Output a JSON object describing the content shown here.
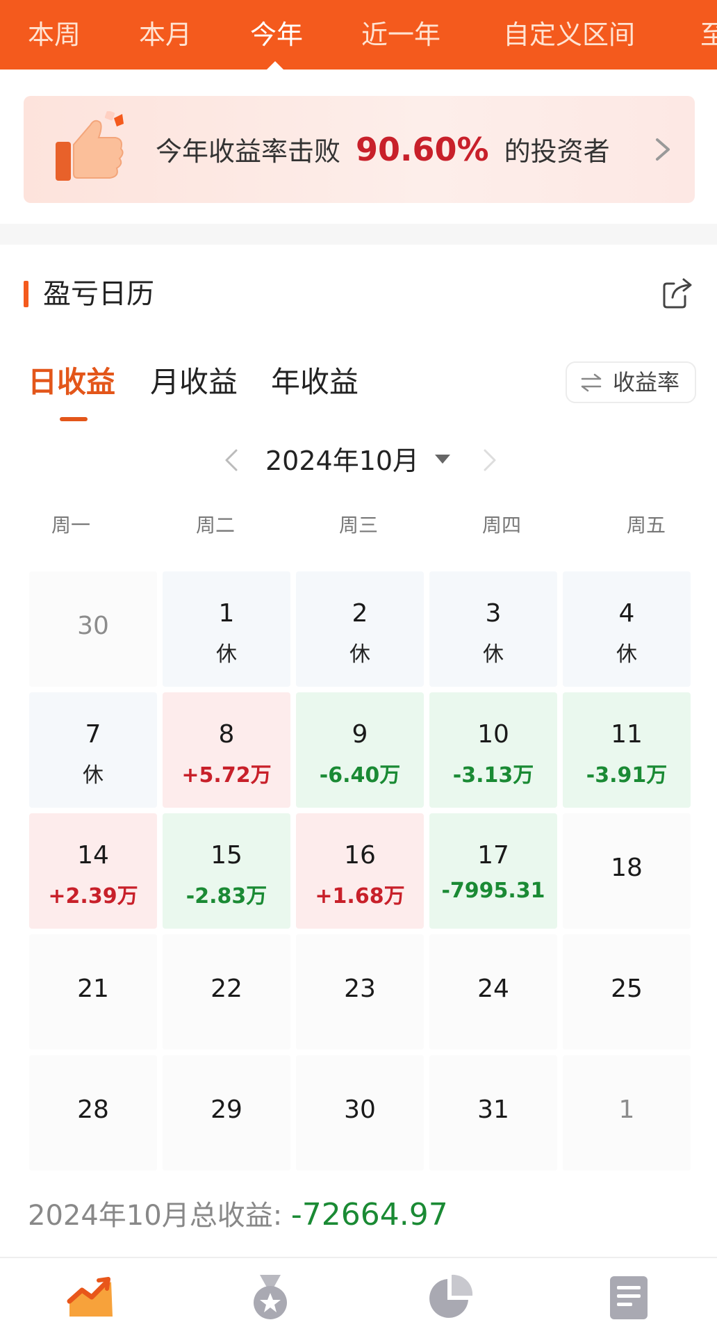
{
  "top_tabs": [
    "本周",
    "本月",
    "今年",
    "近一年",
    "自定义区间",
    "至"
  ],
  "active_tab_index": 2,
  "banner": {
    "text_before": "今年收益率击败",
    "percentage": "90.60%",
    "text_after": "的投资者",
    "icon": "thumbs-up-icon"
  },
  "section": {
    "title": "盈亏日历",
    "share_icon": "share-icon"
  },
  "period_tabs": [
    "日收益",
    "月收益",
    "年收益"
  ],
  "active_period_index": 0,
  "rate_toggle": {
    "icon": "swap-icon",
    "label": "收益率"
  },
  "month_nav": {
    "label": "2024年10月"
  },
  "weekdays": [
    "周一",
    "周二",
    "周三",
    "周四",
    "周五"
  ],
  "calendar": [
    [
      {
        "day": "30",
        "sub": "",
        "state": "other"
      },
      {
        "day": "1",
        "sub": "休",
        "state": "rest"
      },
      {
        "day": "2",
        "sub": "休",
        "state": "rest"
      },
      {
        "day": "3",
        "sub": "休",
        "state": "rest"
      },
      {
        "day": "4",
        "sub": "休",
        "state": "rest"
      }
    ],
    [
      {
        "day": "7",
        "sub": "休",
        "state": "rest"
      },
      {
        "day": "8",
        "sub": "+5.72万",
        "state": "gain"
      },
      {
        "day": "9",
        "sub": "-6.40万",
        "state": "loss"
      },
      {
        "day": "10",
        "sub": "-3.13万",
        "state": "loss"
      },
      {
        "day": "11",
        "sub": "-3.91万",
        "state": "loss"
      }
    ],
    [
      {
        "day": "14",
        "sub": "+2.39万",
        "state": "gain"
      },
      {
        "day": "15",
        "sub": "-2.83万",
        "state": "loss"
      },
      {
        "day": "16",
        "sub": "+1.68万",
        "state": "gain"
      },
      {
        "day": "17",
        "sub": "-7995.31",
        "state": "loss"
      },
      {
        "day": "18",
        "sub": "",
        "state": "future"
      }
    ],
    [
      {
        "day": "21",
        "sub": "",
        "state": "future"
      },
      {
        "day": "22",
        "sub": "",
        "state": "future"
      },
      {
        "day": "23",
        "sub": "",
        "state": "future"
      },
      {
        "day": "24",
        "sub": "",
        "state": "future"
      },
      {
        "day": "25",
        "sub": "",
        "state": "future"
      }
    ],
    [
      {
        "day": "28",
        "sub": "",
        "state": "future"
      },
      {
        "day": "29",
        "sub": "",
        "state": "future"
      },
      {
        "day": "30",
        "sub": "",
        "state": "future"
      },
      {
        "day": "31",
        "sub": "",
        "state": "future"
      },
      {
        "day": "1",
        "sub": "",
        "state": "other"
      }
    ]
  ],
  "total": {
    "label": "2024年10月总收益:",
    "value": "-72664.97"
  },
  "bottom_nav": [
    {
      "icon": "trend-chart-icon",
      "active": true
    },
    {
      "icon": "medal-icon",
      "active": false
    },
    {
      "icon": "pie-chart-icon",
      "active": false
    },
    {
      "icon": "list-document-icon",
      "active": false
    }
  ],
  "colors": {
    "brand": "#f45a1d",
    "gain": "#c8202a",
    "loss": "#1a8a34",
    "gain_bg": "#fdecec",
    "loss_bg": "#eaf8ee"
  }
}
